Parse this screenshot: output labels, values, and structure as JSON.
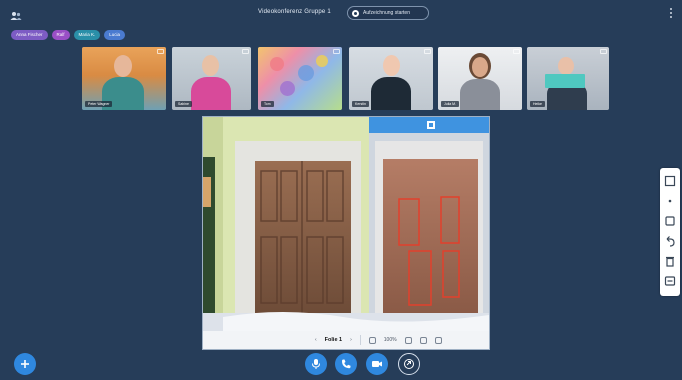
{
  "header": {
    "title": "Videokonferenz Gruppe 1",
    "recording_label": "Aufzeichnung starten"
  },
  "participant_pills": [
    {
      "label": "Anna Fischer",
      "color": "#7d5cc4"
    },
    {
      "label": "Ralf",
      "color": "#9a4fc6"
    },
    {
      "label": "Maria K.",
      "color": "#2a8fa8"
    },
    {
      "label": "Lucia",
      "color": "#4a7bd0"
    }
  ],
  "webcams": [
    {
      "name": "Peter Wagner"
    },
    {
      "name": "Sabine"
    },
    {
      "name": "Tom"
    },
    {
      "name": "Kerstin"
    },
    {
      "name": "Julia M."
    },
    {
      "name": "Heike"
    }
  ],
  "presentation": {
    "slide_number": "Folie 1",
    "zoom": "100%"
  },
  "colors": {
    "background": "#263d59",
    "accent": "#2f88df"
  },
  "icons": {
    "user_list": "users-icon",
    "more": "kebab-icon",
    "actions": "plus-icon",
    "microphone": "microphone-icon",
    "phone": "phone-icon",
    "camera": "video-icon",
    "screenshare": "screenshare-icon"
  }
}
